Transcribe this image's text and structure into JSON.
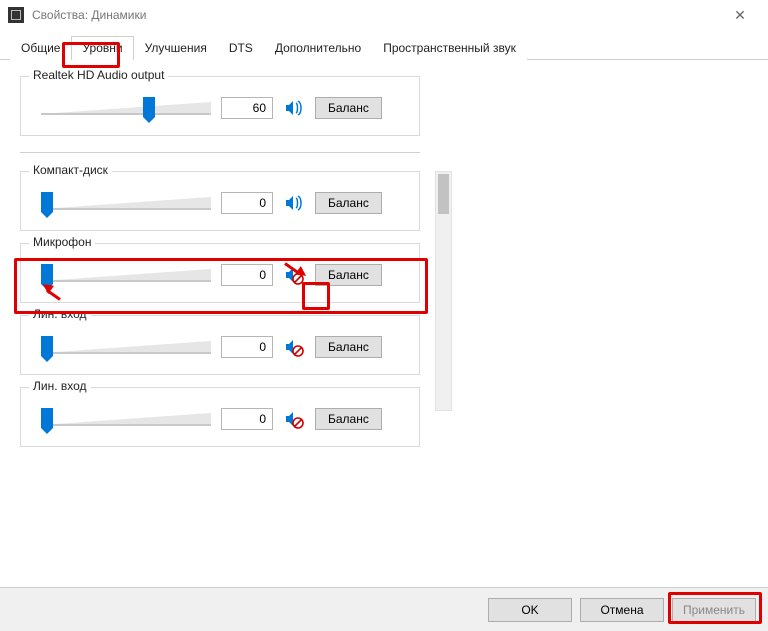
{
  "window": {
    "title": "Свойства: Динамики"
  },
  "tabs": [
    {
      "label": "Общие"
    },
    {
      "label": "Уровни",
      "active": true
    },
    {
      "label": "Улучшения"
    },
    {
      "label": "DTS"
    },
    {
      "label": "Дополнительно"
    },
    {
      "label": "Пространственный звук"
    }
  ],
  "primary": {
    "label": "Realtek HD Audio output",
    "value": "60",
    "slider_percent": 60,
    "muted": false,
    "balance_label": "Баланс"
  },
  "inputs": [
    {
      "label": "Компакт-диск",
      "value": "0",
      "slider_percent": 0,
      "muted": false,
      "balance_label": "Баланс"
    },
    {
      "label": "Микрофон",
      "value": "0",
      "slider_percent": 0,
      "muted": true,
      "balance_label": "Баланс",
      "highlighted": true
    },
    {
      "label": "Лин. вход",
      "value": "0",
      "slider_percent": 0,
      "muted": true,
      "balance_label": "Баланс"
    },
    {
      "label": "Лин. вход",
      "value": "0",
      "slider_percent": 0,
      "muted": true,
      "balance_label": "Баланс"
    }
  ],
  "footer": {
    "ok": "OK",
    "cancel": "Отмена",
    "apply": "Применить"
  }
}
